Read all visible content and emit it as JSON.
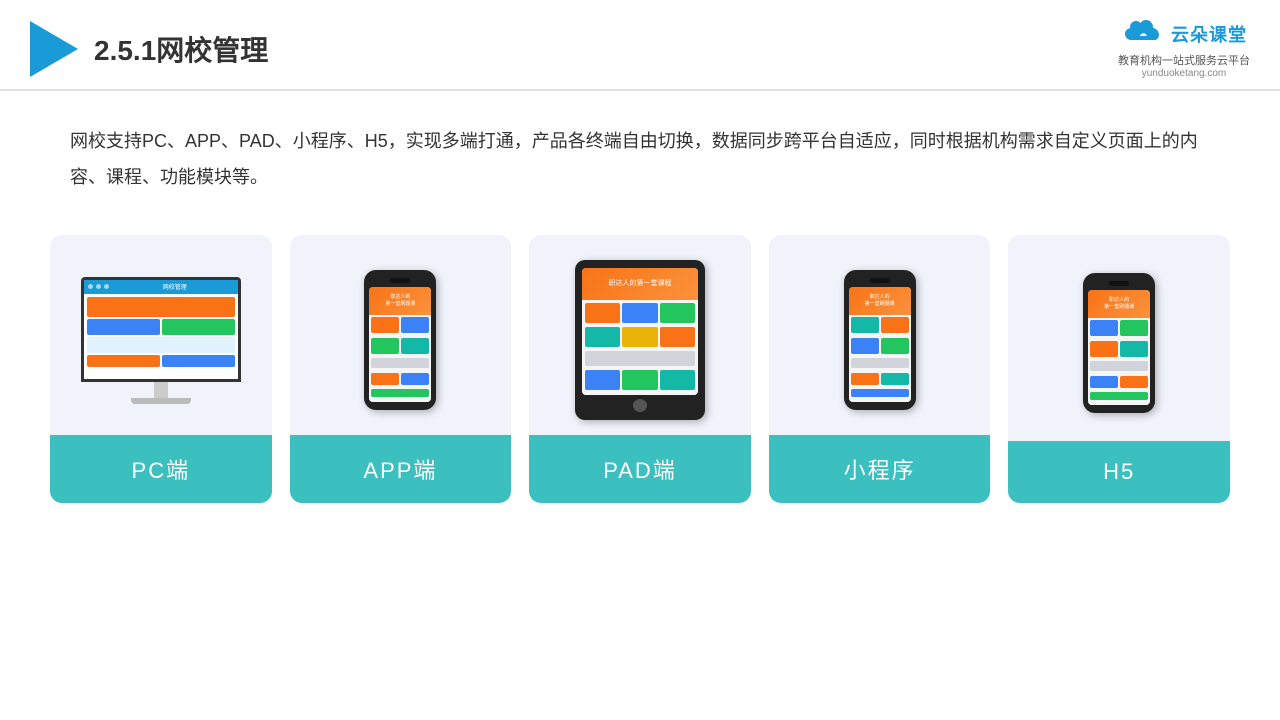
{
  "header": {
    "title": "2.5.1网校管理",
    "brand_name": "云朵课堂",
    "brand_url": "yunduoketang.com",
    "brand_sub": "教育机构一站\n式服务云平台"
  },
  "description": {
    "text": "网校支持PC、APP、PAD、小程序、H5，实现多端打通，产品各终端自由切换，数据同步跨平台自适应，同时根据机构需求自定义页面上的内容、课程、功能模块等。"
  },
  "cards": [
    {
      "label": "PC端",
      "type": "pc"
    },
    {
      "label": "APP端",
      "type": "phone"
    },
    {
      "label": "PAD端",
      "type": "tablet"
    },
    {
      "label": "小程序",
      "type": "phone2"
    },
    {
      "label": "H5",
      "type": "phone3"
    }
  ]
}
